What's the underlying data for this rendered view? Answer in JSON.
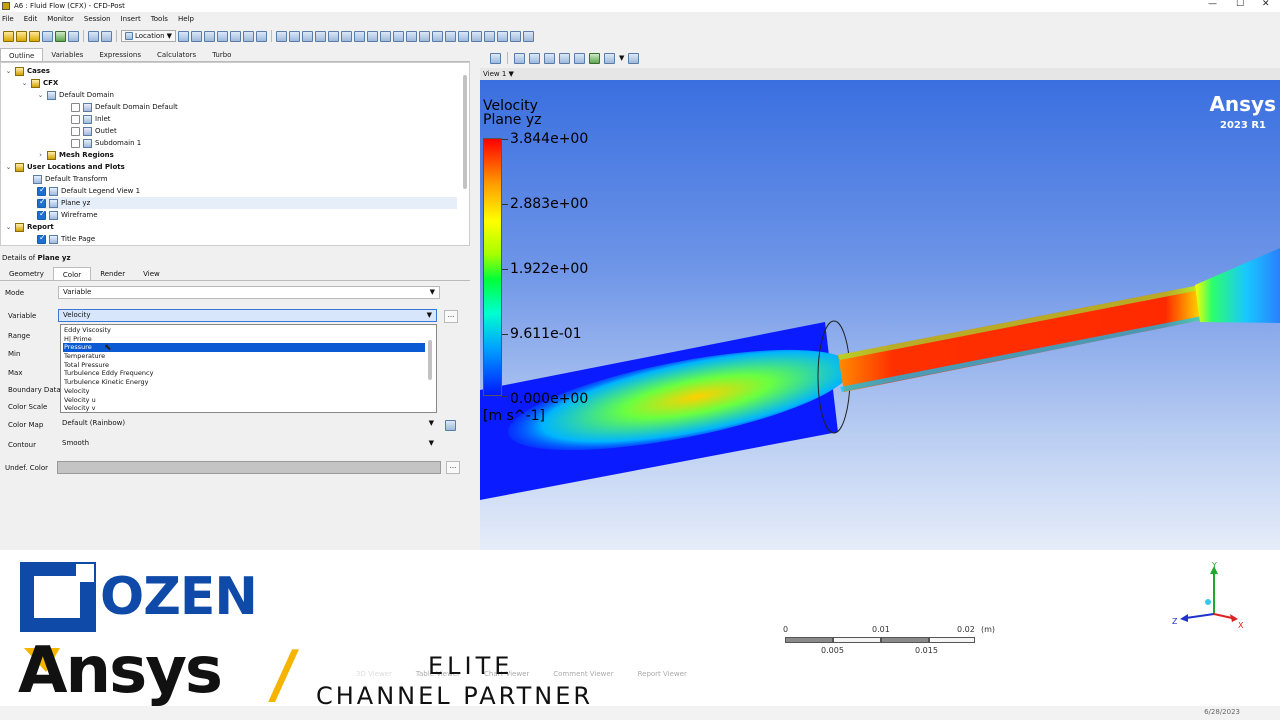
{
  "window": {
    "title": "A6 : Fluid Flow (CFX) - CFD-Post",
    "controls": [
      "—",
      "☐",
      "✕"
    ]
  },
  "menu": [
    "File",
    "Edit",
    "Monitor",
    "Session",
    "Insert",
    "Tools",
    "Help"
  ],
  "toolbar": {
    "location_label": "Location"
  },
  "left_tabs": [
    "Outline",
    "Variables",
    "Expressions",
    "Calculators",
    "Turbo"
  ],
  "tree": {
    "cases": "Cases",
    "cfx": "CFX",
    "default_domain": "Default Domain",
    "domain_items": [
      "Default Domain Default",
      "Inlet",
      "Outlet",
      "Subdomain 1"
    ],
    "mesh_regions": "Mesh Regions",
    "user_locations": "User Locations and Plots",
    "ul_items": [
      "Default Transform",
      "Default Legend View 1",
      "Plane yz",
      "Wireframe"
    ],
    "report": "Report",
    "report_items": [
      "Title Page"
    ]
  },
  "details": {
    "title_prefix": "Details of ",
    "title_obj": "Plane yz",
    "tabs": [
      "Geometry",
      "Color",
      "Render",
      "View"
    ],
    "labels": {
      "mode": "Mode",
      "variable": "Variable",
      "range": "Range",
      "min": "Min",
      "max": "Max",
      "boundary": "Boundary Data",
      "color_scale": "Color Scale",
      "color_map": "Color Map",
      "contour": "Contour",
      "undef": "Undef. Color"
    },
    "mode_value": "Variable",
    "variable_value": "Velocity",
    "color_map_value": "Default (Rainbow)",
    "contour_value": "Smooth",
    "dots": "...",
    "dropdown": [
      "Eddy Viscosity",
      "H| Prime",
      "Pressure",
      "Temperature",
      "Total Pressure",
      "Turbulence Eddy Frequency",
      "Turbulence Kinetic Energy",
      "Velocity",
      "Velocity u",
      "Velocity v"
    ],
    "dropdown_selected": "Pressure"
  },
  "viewer": {
    "view_title": "View 1",
    "legend_title": "Velocity",
    "legend_subtitle": "Plane yz",
    "ticks": [
      "3.844e+00",
      "2.883e+00",
      "1.922e+00",
      "9.611e-01",
      "0.000e+00"
    ],
    "units": "[m s^-1]",
    "brand": "Ansys",
    "version": "2023 R1"
  },
  "scale_bar": {
    "top": [
      "0",
      "0.01",
      "0.02",
      "(m)"
    ],
    "bottom": [
      "0.005",
      "0.015"
    ]
  },
  "axes": {
    "x": "X",
    "y": "Y",
    "z": "Z"
  },
  "bottom_tabs": [
    "3D Viewer",
    "Table Viewer",
    "Chart Viewer",
    "Comment Viewer",
    "Report Viewer"
  ],
  "date": "6/28/2023",
  "banner": {
    "ozen": "OZEN",
    "ansys": "Ansys",
    "slash": "/",
    "elite": "ELITE",
    "partner": "CHANNEL PARTNER"
  }
}
